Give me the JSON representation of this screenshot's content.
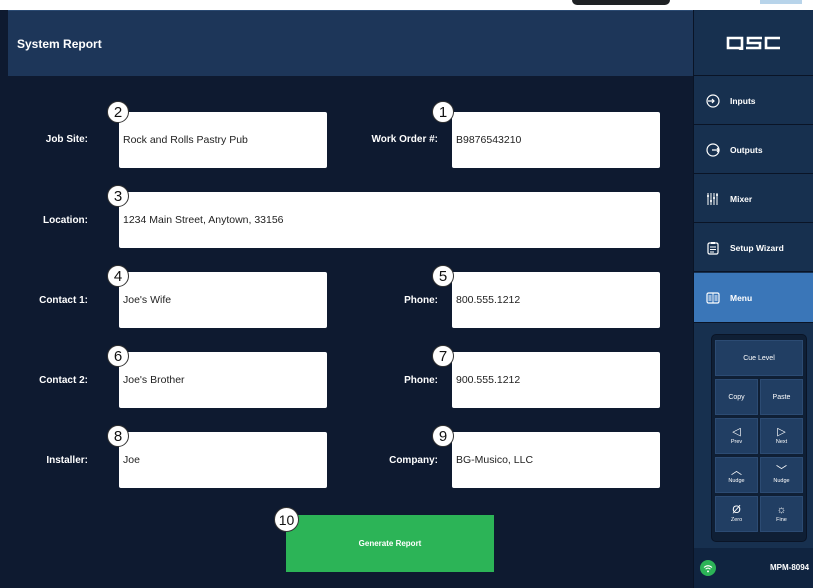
{
  "header": {
    "title": "System Report"
  },
  "form": {
    "job_site": {
      "label": "Job Site:",
      "value": "Rock and Rolls Pastry Pub",
      "badge": "2"
    },
    "work_order": {
      "label": "Work Order #:",
      "value": "B9876543210",
      "badge": "1"
    },
    "location": {
      "label": "Location:",
      "value": "1234 Main Street, Anytown, 33156",
      "badge": "3"
    },
    "contact1": {
      "label": "Contact 1:",
      "value": "Joe's Wife",
      "badge": "4"
    },
    "phone1": {
      "label": "Phone:",
      "value": "800.555.1212",
      "badge": "5"
    },
    "contact2": {
      "label": "Contact 2:",
      "value": "Joe's Brother",
      "badge": "6"
    },
    "phone2": {
      "label": "Phone:",
      "value": "900.555.1212",
      "badge": "7"
    },
    "installer": {
      "label": "Installer:",
      "value": "Joe",
      "badge": "8"
    },
    "company": {
      "label": "Company:",
      "value": "BG-Musico, LLC",
      "badge": "9"
    },
    "generate": {
      "label": "Generate Report",
      "badge": "10"
    }
  },
  "sidebar": {
    "logo": "QSC",
    "items": [
      {
        "label": "Inputs",
        "icon": "input-icon"
      },
      {
        "label": "Outputs",
        "icon": "output-icon"
      },
      {
        "label": "Mixer",
        "icon": "mixer-icon"
      },
      {
        "label": "Setup Wizard",
        "icon": "clipboard-icon"
      },
      {
        "label": "Menu",
        "icon": "menu-icon",
        "active": true
      }
    ],
    "keypad": {
      "cue_level": "Cue Level",
      "copy": "Copy",
      "paste": "Paste",
      "prev": "Prev",
      "next": "Next",
      "nudge_up": "Nudge",
      "nudge_down": "Nudge",
      "zero": "Zero",
      "fine": "Fine"
    },
    "device": "MPM-8094"
  },
  "colors": {
    "background": "#0e1a30",
    "header": "#1d3659",
    "sidebar": "#17304f",
    "active": "#3a76b8",
    "button": "#2cb457"
  }
}
